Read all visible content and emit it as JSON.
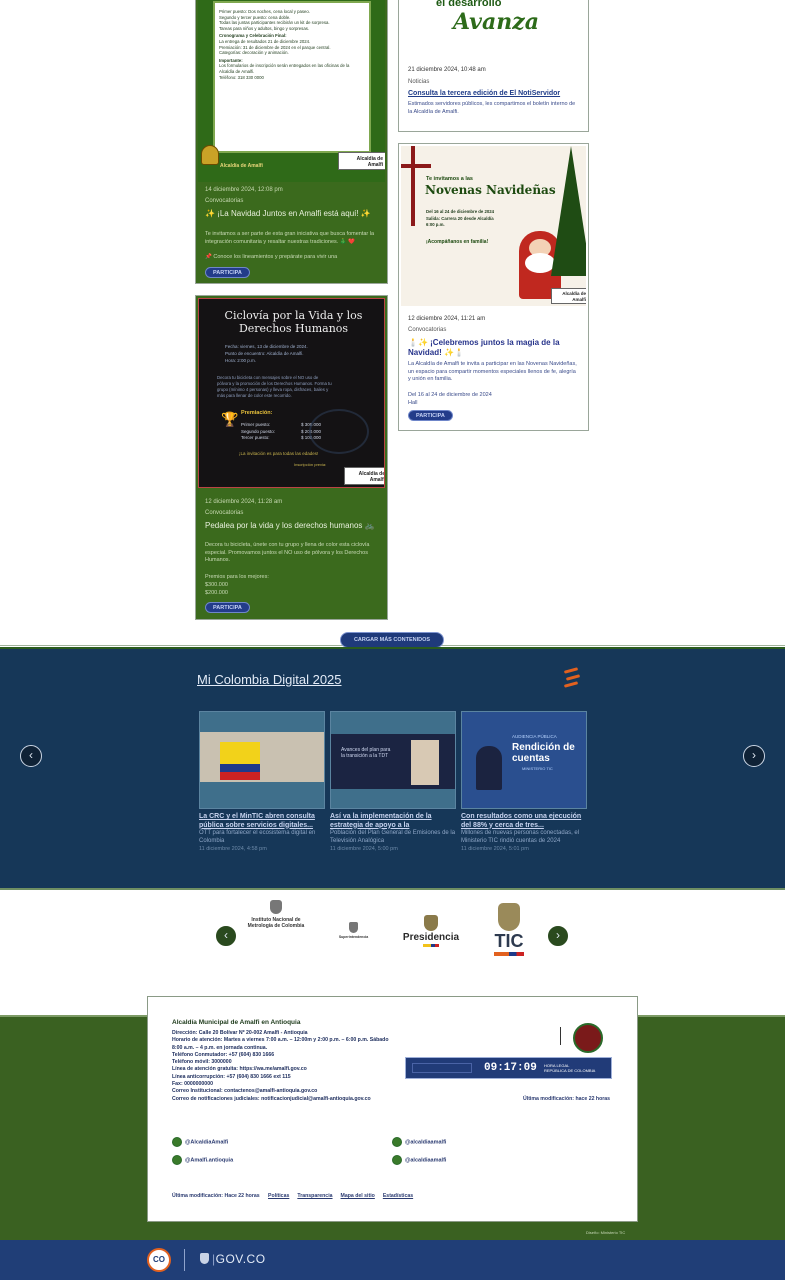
{
  "cards": {
    "card1": {
      "poster_lines": [
        "Primer puesto: Dos noches, cena local y paseo.",
        "Segundo y tercer puesto: cena doble.",
        "Todas las juntas participantes recibirán un kit de sorpresa.",
        "Tareas para niños y adultos, bingo y sorpresas.",
        "Cronograma y Celebración Final:",
        "La entrega de resultados 21 de diciembre 2024.",
        "Premiación: 31 de diciembre de 2024 en el parque central.",
        "Categorías: decoración y animación.",
        "Importante:",
        "Los formularios de inscripción serán entregados en las oficinas de la Alcaldía de Amalfi.",
        "Teléfono: 318 330 0000"
      ],
      "date": "14 diciembre 2024, 12:08 pm",
      "category": "Convocatorias",
      "title": "✨ ¡La Navidad Juntos en Amalfi está aquí! ✨",
      "body": "Te invitamos a ser parte de esta gran iniciativa que busca fomentar la integración comunitaria y resaltar nuestras tradiciones. 🎄 ❤️",
      "body2": "📌 Conoce los lineamientos y prepárate para vivir una",
      "button": "PARTICIPA"
    },
    "card2": {
      "poster_title_top": "el desarrollo",
      "poster_title": "Avanza",
      "date": "21 diciembre 2024, 10:48 am",
      "category": "Noticias",
      "title": "Consulta la tercera edición de El NotiServidor",
      "body": "Estimados servidores públicos, les compartimos el boletín interno de la Alcaldía de Amalfi."
    },
    "card3": {
      "poster_title": "Ciclovía por la Vida y los Derechos Humanos",
      "poster_items": [
        "Fecha: viernes, 13 de diciembre de 2024.",
        "Punto de encuentro: Alcaldía de Amalfi.",
        "Hora: 2:00 p.m."
      ],
      "poster_text": "Decora tu bicicleta con mensajes sobre el NO uso de pólvora y la promoción de los Derechos Humanos. Forma tu grupo (mínimo 4 personas) y lleva ropa, disfraces, bailes y más para llenar de color este recorrido.",
      "prizes_label": "Premiación:",
      "prizes": [
        [
          "Primer puesto:",
          "$ 300.000"
        ],
        [
          "Segundo puesto:",
          "$ 200.000"
        ],
        [
          "Tercer puesto:",
          "$ 100.000"
        ]
      ],
      "invite": "¡La invitación es para todas las edades!",
      "register": "Inscripción previa:",
      "date": "12 diciembre 2024, 11:28 am",
      "category": "Convocatorias",
      "title": "Pedalea por la vida y los derechos humanos 🚲",
      "body": "Decora tu bicicleta, únete con tu grupo y llena de color esta ciclovía especial. Promovamos juntos el NO uso de pólvora y los Derechos Humanos.",
      "body2": "Premios para los mejores:",
      "body3": "$300.000",
      "body4": "$200.000",
      "button": "PARTICIPA"
    },
    "card4": {
      "poster_kicker": "Te invitamos a las",
      "poster_title": "Novenas Navideñas",
      "poster_items": [
        "Del 16 al 24 de diciembre de 2024",
        "Salida: Carrera 20 desde Alcaldía",
        "6:00 p.m."
      ],
      "poster_cta": "¡Acompáñanos en familia!",
      "date": "12 diciembre 2024, 11:21 am",
      "category": "Convocatorias",
      "title": "🕯️✨ ¡Celebremos juntos la magia de la Navidad! ✨🕯️",
      "body": "La Alcaldía de Amalfi te invita a participar en las Novenas Navideñas, un espacio para compartir momentos especiales llenos de fe, alegría y unión en familia.",
      "body2": "Del 16 al 24 de diciembre de 2024",
      "body3": "Hall",
      "button": "PARTICIPA"
    }
  },
  "logo_text": "Alcaldía de Amalfi",
  "load_more": "CARGAR MÁS CONTENIDOS",
  "banner": {
    "title": "Mi Colombia Digital 2025",
    "items": [
      {
        "title": "La CRC y el MinTIC abren consulta pública sobre servicios digitales...",
        "desc": "OTT para fortalecer el ecosistema digital en Colombia",
        "date": "11 diciembre 2024, 4:58 pm"
      },
      {
        "thumb_text": "Avances del plan para la transición a la TDT",
        "title": "Así va la implementación de la estrategia de apoyo a la",
        "desc": "Población del Plan General de Emisiones de la Televisión Analógica",
        "date": "11 diciembre 2024, 5:00 pm"
      },
      {
        "thumb_kicker": "AUDIENCIA PÚBLICA",
        "thumb_title": "Rendición de cuentas",
        "thumb_sub": "MINISTERIO TIC",
        "title": "Con resultados como una ejecución del 88% y cerca de tres...",
        "desc": "Millones de nuevas personas conectadas, el Ministerio TIC rindió cuentas de 2024",
        "date": "11 diciembre 2024, 5:01 pm"
      }
    ]
  },
  "partners": {
    "p1": "Instituto Nacional de Metrología de Colombia",
    "p2": "Superintendencia",
    "p3": "Presidencia",
    "p4": "TIC"
  },
  "footer": {
    "org": "Alcaldía Municipal de Amalfi en Antioquia",
    "lines": [
      "Dirección: Calle 20 Bolívar Nº 20-002 Amalfi - Antioquia",
      "Horario de atención: Martes a viernes 7:00 a.m. – 12:00m y 2:00 p.m. – 6:00 p.m. Sábado",
      "8:00 a.m. – 4 p.m. en jornada continua.",
      "Teléfono Conmutador: +57 (604) 830 1666",
      "Teléfono móvil: 3000000",
      "Línea de atención gratuita: https://wa.me/amalfi.gov.co",
      "Línea anticorrupción: +57 (604) 830 1666 ext 115",
      "Fax: 0000000000",
      "Correo Institucional: contactenos@amalfi-antioquia.gov.co",
      "Correo de notificaciones judiciales: notificacionjudicial@amalfi-antioquia.gov.co"
    ],
    "clock": "09:17:09",
    "clock_label": "HORA LEGAL\nREPÚBLICA DE COLOMBIA",
    "last_mod_right": "Última modificación: hace 22 horas",
    "social": [
      "@AlcaldiaAmalfi",
      "@alcaldiaamalfi",
      "@Amalfi.antioquia",
      "@alcaldiaamalfi"
    ],
    "last_mod": "Última modificación: Hace 22 horas",
    "links": [
      "Políticas",
      "Transparencia",
      "Mapa del sitio",
      "Estadísticas"
    ],
    "credit": "Diseño: Ministerio TIC"
  },
  "govco": {
    "label": "GOV.CO",
    "badge": "CO"
  }
}
